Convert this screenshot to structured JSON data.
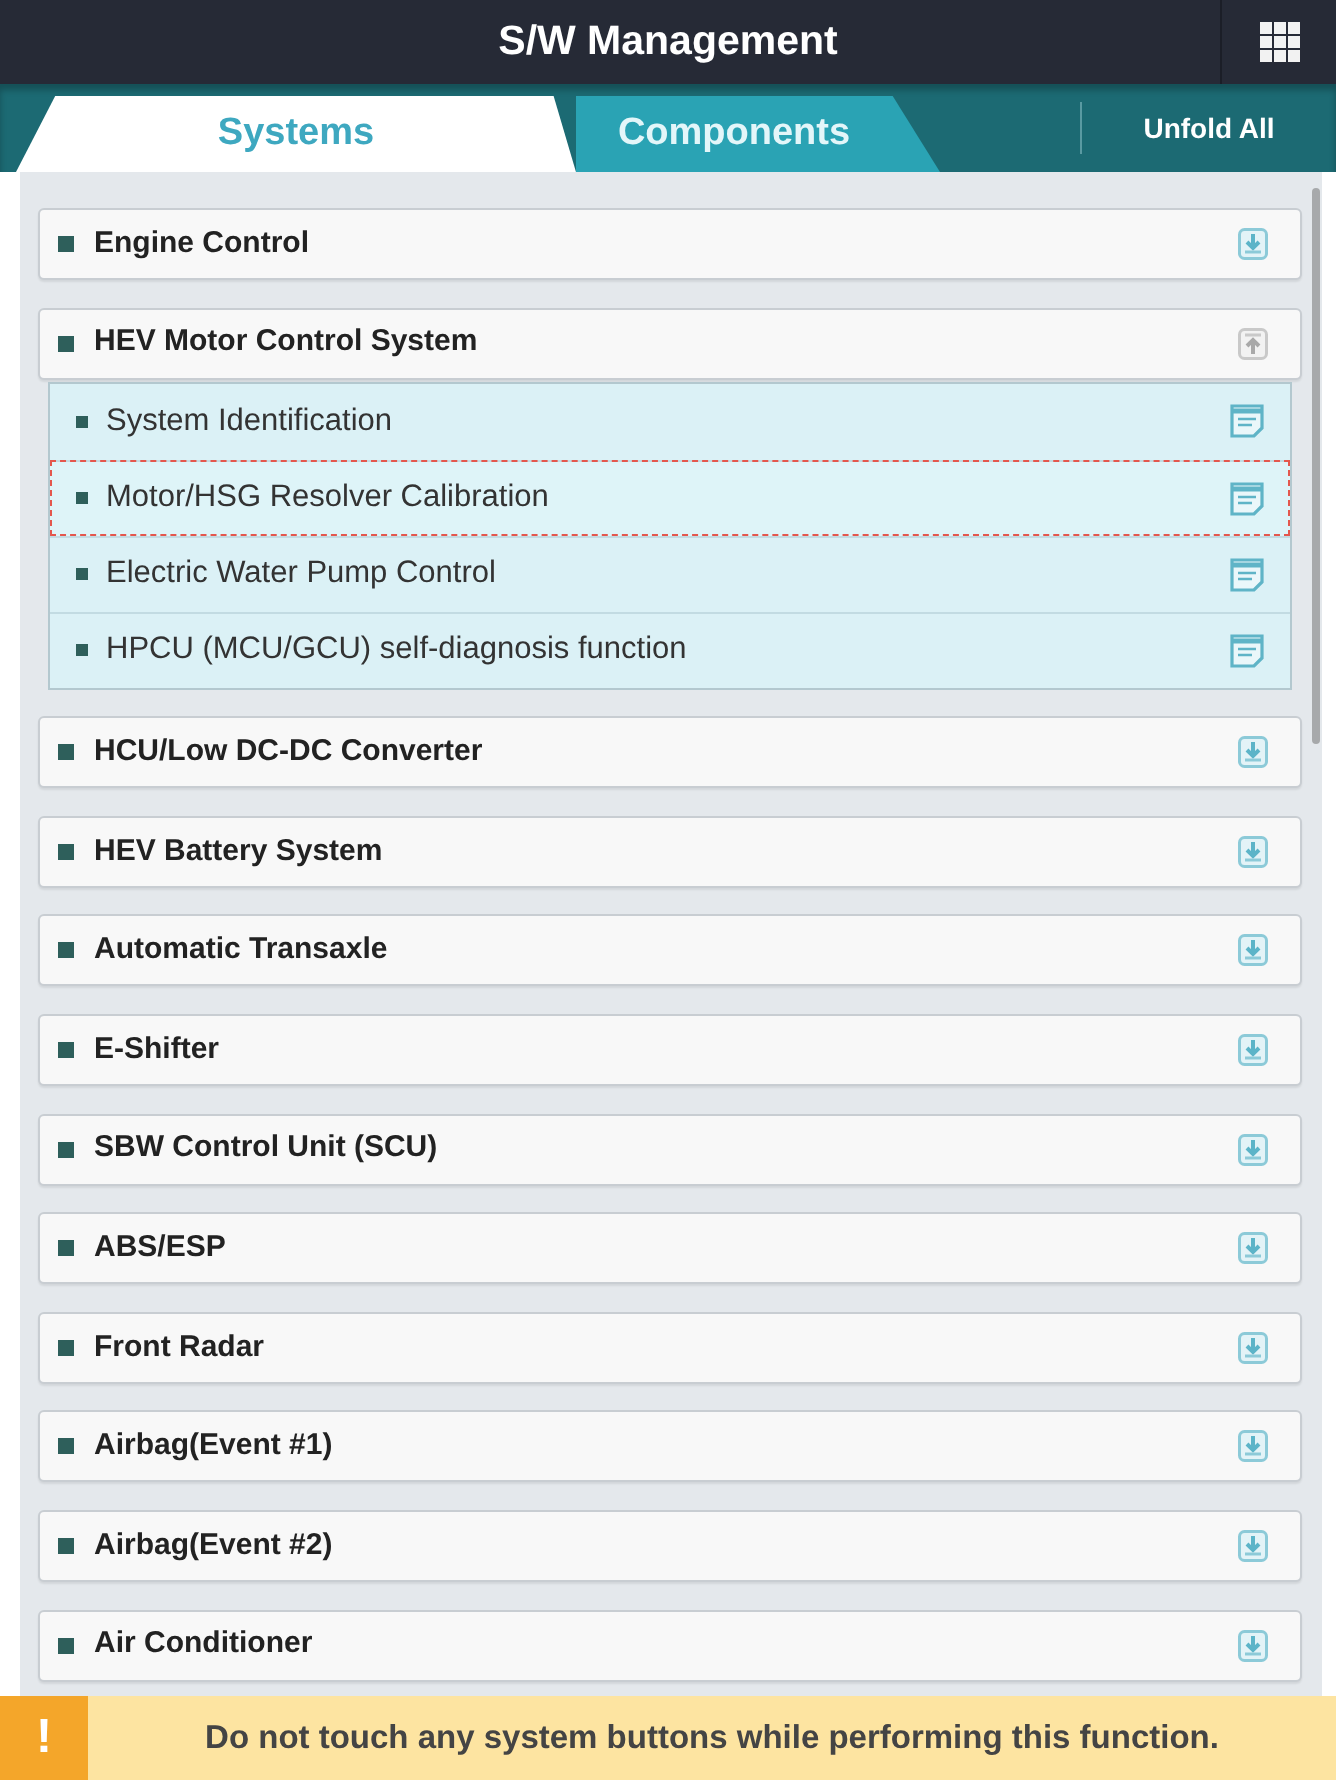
{
  "header": {
    "title": "S/W Management"
  },
  "tabs": [
    {
      "label": "Systems",
      "selected": true
    },
    {
      "label": "Components",
      "selected": false
    }
  ],
  "unfold_all": {
    "label": "Unfold All"
  },
  "systems": [
    {
      "name": "Engine Control",
      "expanded": false
    },
    {
      "name": "HEV Motor Control System",
      "expanded": true,
      "children": [
        {
          "name": "System Identification",
          "selected": false
        },
        {
          "name": "Motor/HSG Resolver Calibration",
          "selected": true
        },
        {
          "name": "Electric Water Pump Control",
          "selected": false
        },
        {
          "name": "HPCU (MCU/GCU) self-diagnosis function",
          "selected": false
        }
      ]
    },
    {
      "name": "HCU/Low DC-DC Converter",
      "expanded": false
    },
    {
      "name": "HEV Battery System",
      "expanded": false
    },
    {
      "name": "Automatic Transaxle",
      "expanded": false
    },
    {
      "name": "E-Shifter",
      "expanded": false
    },
    {
      "name": "SBW Control Unit (SCU)",
      "expanded": false
    },
    {
      "name": "ABS/ESP",
      "expanded": false
    },
    {
      "name": "Front Radar",
      "expanded": false
    },
    {
      "name": "Airbag(Event #1)",
      "expanded": false
    },
    {
      "name": "Airbag(Event #2)",
      "expanded": false
    },
    {
      "name": "Air Conditioner",
      "expanded": false
    }
  ],
  "warning": {
    "icon": "!",
    "message": "Do not touch any system buttons while performing this function."
  }
}
